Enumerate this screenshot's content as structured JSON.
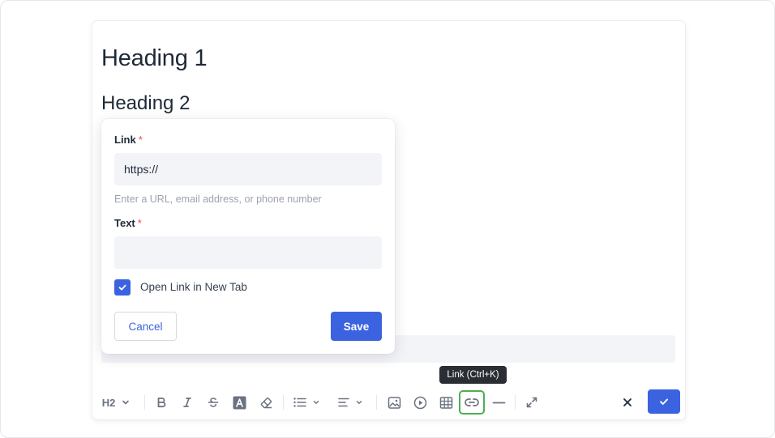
{
  "content": {
    "heading1": "Heading 1",
    "heading2": "Heading 2"
  },
  "link_popover": {
    "link_label": "Link",
    "link_required": "*",
    "link_value": "https://",
    "link_hint": "Enter a URL, email address, or phone number",
    "text_label": "Text",
    "text_required": "*",
    "text_value": "",
    "open_new_tab_label": "Open Link in New Tab",
    "open_new_tab_checked": true,
    "cancel_label": "Cancel",
    "save_label": "Save"
  },
  "tooltip": {
    "text": "Link (Ctrl+K)"
  },
  "toolbar": {
    "heading_level": "H2",
    "active_tool": "link",
    "tools": [
      "heading",
      "bold",
      "italic",
      "strikethrough",
      "text-color",
      "clear-format",
      "list",
      "align",
      "image",
      "video",
      "table",
      "link",
      "horizontal-rule",
      "fullscreen"
    ]
  },
  "colors": {
    "accent": "#3b63e0",
    "active_outline": "#4caf50",
    "required": "#ef4444"
  }
}
